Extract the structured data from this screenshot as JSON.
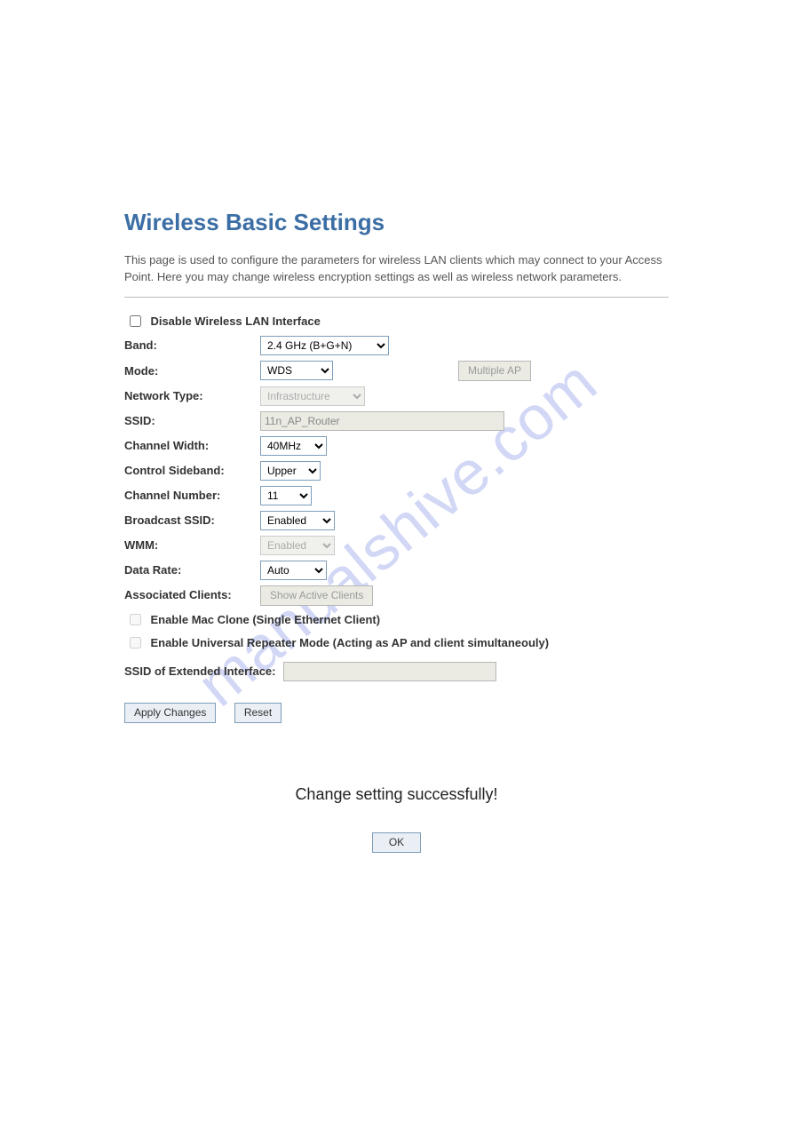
{
  "title": "Wireless Basic Settings",
  "description": "This page is used to configure the parameters for wireless LAN clients which may connect to your Access Point. Here you may change wireless encryption settings as well as wireless network parameters.",
  "disable_wlan_label": "Disable Wireless LAN Interface",
  "band": {
    "label": "Band:",
    "value": "2.4 GHz (B+G+N)"
  },
  "mode": {
    "label": "Mode:",
    "value": "WDS",
    "multiple_ap": "Multiple AP"
  },
  "network_type": {
    "label": "Network Type:",
    "value": "Infrastructure"
  },
  "ssid": {
    "label": "SSID:",
    "value": "11n_AP_Router"
  },
  "channel_width": {
    "label": "Channel Width:",
    "value": "40MHz"
  },
  "control_sideband": {
    "label": "Control Sideband:",
    "value": "Upper"
  },
  "channel_number": {
    "label": "Channel Number:",
    "value": "11"
  },
  "broadcast_ssid": {
    "label": "Broadcast SSID:",
    "value": "Enabled"
  },
  "wmm": {
    "label": "WMM:",
    "value": "Enabled"
  },
  "data_rate": {
    "label": "Data Rate:",
    "value": "Auto"
  },
  "assoc_clients": {
    "label": "Associated Clients:",
    "button": "Show Active Clients"
  },
  "mac_clone_label": "Enable Mac Clone (Single Ethernet Client)",
  "repeater_label": "Enable Universal Repeater Mode (Acting as AP and client simultaneouly)",
  "ssid_ext": {
    "label": "SSID of Extended Interface:",
    "value": ""
  },
  "apply_label": "Apply Changes",
  "reset_label": "Reset",
  "success_message": "Change setting successfully!",
  "ok_label": "OK",
  "watermark": "manualshive.com"
}
